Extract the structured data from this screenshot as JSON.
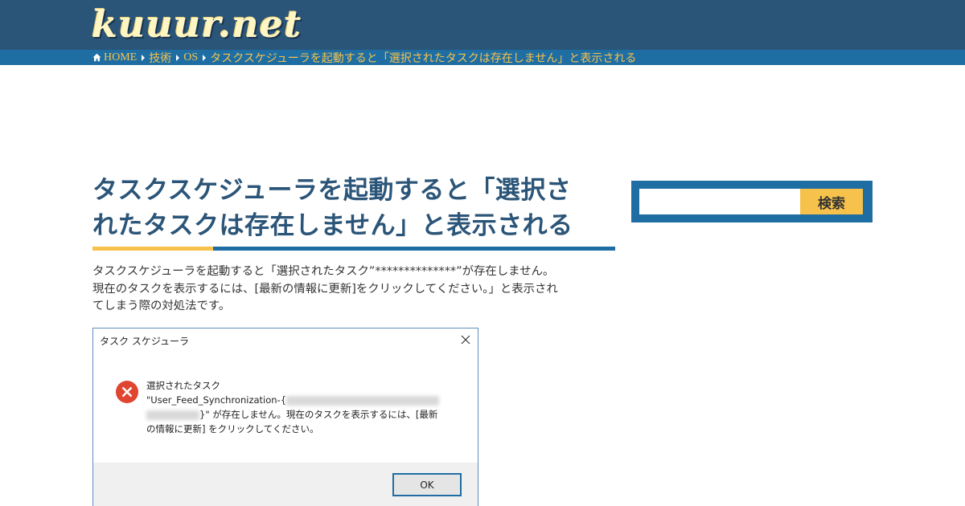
{
  "site": {
    "logo": "kuuur.net"
  },
  "breadcrumb": {
    "home": "HOME",
    "items": [
      "技術",
      "OS",
      "タスクスケジューラを起動すると「選択されたタスクは存在しません」と表示される"
    ]
  },
  "article": {
    "title_line1": "タスクスケジューラを起動すると「選択さ",
    "title_line2": "れたタスクは存在しません」と表示される",
    "lead_line1": "タスクスケジューラを起動すると「選択されたタスク”**************”が存在しません。",
    "lead_line2": "現在のタスクを表示するには、[最新の情報に更新]をクリックしてください。」と表示され",
    "lead_line3": "てしまう際の対処法です。"
  },
  "dialog": {
    "title": "タスク スケジューラ",
    "msg_line1": "選択されたタスク",
    "msg_line2": "\"User_Feed_Synchronization-{",
    "msg_line3": "}\" が存在しません。現在のタスクを表示するには、[最新",
    "msg_line4": "の情報に更新] をクリックしてください。",
    "ok_label": "OK"
  },
  "sidebar": {
    "search_placeholder": "",
    "search_button": "検索"
  },
  "colors": {
    "header": "#2b5578",
    "breadcrumb_bar": "#1f6ea3",
    "accent": "#f7c24b",
    "title_text": "#2b5578",
    "error_red": "#e0452f"
  },
  "icons": [
    "home-icon",
    "chevron-right-icon",
    "close-icon",
    "error-icon"
  ]
}
